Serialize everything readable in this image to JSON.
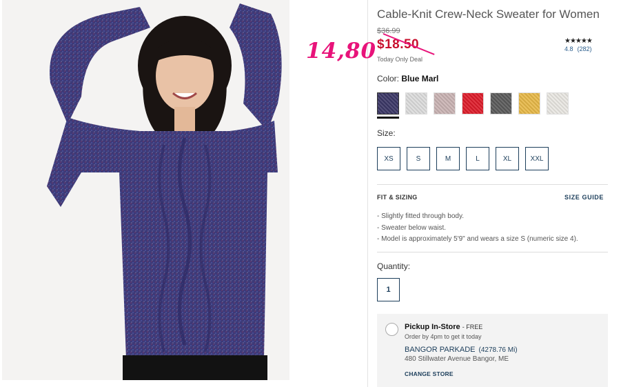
{
  "product": {
    "title": "Cable-Knit Crew-Neck Sweater for Women",
    "original_price": "$36.99",
    "sale_price": "$18.50",
    "deal_note": "Today Only Deal",
    "overlay_price": "14,80"
  },
  "rating": {
    "stars": "★★★★★",
    "value": "4.8",
    "count": "(282)"
  },
  "color": {
    "label": "Color:",
    "selected": "Blue Marl",
    "swatches": [
      {
        "name": "Blue Marl",
        "hex": "#3b3766"
      },
      {
        "name": "light gray",
        "hex": "#dcdcdc"
      },
      {
        "name": "pink",
        "hex": "#c9b3b3"
      },
      {
        "name": "red",
        "hex": "#dd1c2a"
      },
      {
        "name": "charcoal",
        "hex": "#5a5a5a"
      },
      {
        "name": "yellow",
        "hex": "#e7b848"
      },
      {
        "name": "cream",
        "hex": "#e9e7e2"
      }
    ]
  },
  "size": {
    "label": "Size:",
    "options": [
      "XS",
      "S",
      "M",
      "L",
      "XL",
      "XXL"
    ]
  },
  "fit": {
    "title": "FIT & SIZING",
    "size_guide": "SIZE GUIDE",
    "items": [
      "Slightly fitted through body.",
      "Sweater below waist.",
      "Model is approximately 5'9\" and wears a size S (numeric size 4)."
    ]
  },
  "quantity": {
    "label": "Quantity:",
    "value": "1"
  },
  "pickup": {
    "title": "Pickup In-Store",
    "free": "- FREE",
    "order_note": "Order by 4pm to get it today",
    "store_name": "BANGOR PARKADE",
    "distance": "(4278.76 Mi)",
    "address": "480 Stillwater Avenue Bangor, ME",
    "change_store": "CHANGE STORE"
  }
}
